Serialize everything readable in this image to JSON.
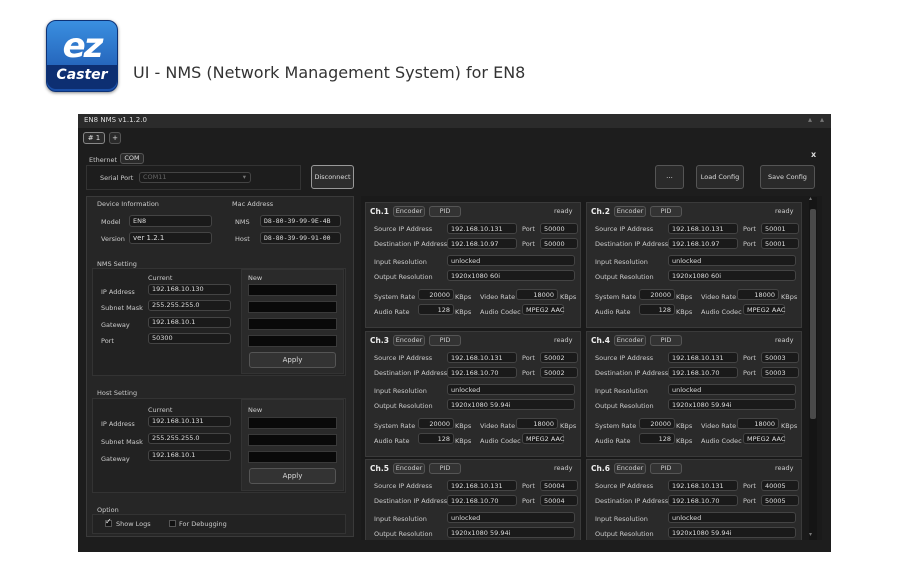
{
  "header": {
    "logo_top": "ez",
    "logo_bottom": "Caster",
    "caption": "UI - NMS (Network Management System) for EN8"
  },
  "window": {
    "title": "EN8 NMS v1.1.2.0",
    "tab": "# 1",
    "add_tab": "+",
    "close": "x"
  },
  "conn": {
    "tab_ethernet": "Ethernet",
    "tab_com": "COM",
    "serial_label": "Serial Port",
    "serial_value": "COM11",
    "disconnect": "Disconnect",
    "dots": "...",
    "load": "Load Config",
    "save": "Save Config"
  },
  "device": {
    "title": "Device Information",
    "model_label": "Model",
    "model": "EN8",
    "version_label": "Version",
    "version": "ver 1.2.1",
    "mac_title": "Mac Address",
    "nms_label": "NMS",
    "nms_mac": "D8-80-39-99-9E-4B",
    "host_label": "Host",
    "host_mac": "D8-80-39-99-91-00"
  },
  "nms": {
    "title": "NMS Setting",
    "current": "Current",
    "new": "New",
    "ip_label": "IP Address",
    "ip": "192.168.10.130",
    "mask_label": "Subnet Mask",
    "mask": "255.255.255.0",
    "gw_label": "Gateway",
    "gw": "192.168.10.1",
    "port_label": "Port",
    "port": "50300",
    "apply": "Apply"
  },
  "host": {
    "title": "Host Setting",
    "current": "Current",
    "new": "New",
    "ip_label": "IP Address",
    "ip": "192.168.10.131",
    "mask_label": "Subnet Mask",
    "mask": "255.255.255.0",
    "gw_label": "Gateway",
    "gw": "192.168.10.1",
    "apply": "Apply"
  },
  "option": {
    "title": "Option",
    "show_logs": "Show Logs",
    "debug": "For Debugging",
    "check": "✓"
  },
  "labels": {
    "encoder": "Encoder",
    "pid": "PID",
    "src": "Source IP Address",
    "dst": "Destination IP Address",
    "port": "Port",
    "input_res": "Input Resolution",
    "output_res": "Output Resolution",
    "sys_rate": "System Rate",
    "kbps": "KBps",
    "video_rate": "Video Rate",
    "audio_rate": "Audio Rate",
    "audio_codec": "Audio Codec"
  },
  "channels": [
    {
      "name": "Ch.1",
      "status": "ready",
      "src_ip": "192.168.10.131",
      "src_port": "50000",
      "dst_ip": "192.168.10.97",
      "dst_port": "50000",
      "input_res": "unlocked",
      "output_res": "1920x1080 60i",
      "system_rate": "20000",
      "video_rate": "18000",
      "audio_rate": "128",
      "audio_codec": "MPEG2 AAC"
    },
    {
      "name": "Ch.2",
      "status": "ready",
      "src_ip": "192.168.10.131",
      "src_port": "50001",
      "dst_ip": "192.168.10.97",
      "dst_port": "50001",
      "input_res": "unlocked",
      "output_res": "1920x1080 60i",
      "system_rate": "20000",
      "video_rate": "18000",
      "audio_rate": "128",
      "audio_codec": "MPEG2 AAC"
    },
    {
      "name": "Ch.3",
      "status": "ready",
      "src_ip": "192.168.10.131",
      "src_port": "50002",
      "dst_ip": "192.168.10.70",
      "dst_port": "50002",
      "input_res": "unlocked",
      "output_res": "1920x1080 59.94i",
      "system_rate": "20000",
      "video_rate": "18000",
      "audio_rate": "128",
      "audio_codec": "MPEG2 AAC"
    },
    {
      "name": "Ch.4",
      "status": "ready",
      "src_ip": "192.168.10.131",
      "src_port": "50003",
      "dst_ip": "192.168.10.70",
      "dst_port": "50003",
      "input_res": "unlocked",
      "output_res": "1920x1080 59.94i",
      "system_rate": "20000",
      "video_rate": "18000",
      "audio_rate": "128",
      "audio_codec": "MPEG2 AAC"
    },
    {
      "name": "Ch.5",
      "status": "ready",
      "src_ip": "192.168.10.131",
      "src_port": "50004",
      "dst_ip": "192.168.10.70",
      "dst_port": "50004",
      "input_res": "unlocked",
      "output_res": "1920x1080 59.94i",
      "system_rate": "",
      "video_rate": "",
      "audio_rate": "",
      "audio_codec": ""
    },
    {
      "name": "Ch.6",
      "status": "ready",
      "src_ip": "192.168.10.131",
      "src_port": "40005",
      "dst_ip": "192.168.10.70",
      "dst_port": "50005",
      "input_res": "unlocked",
      "output_res": "1920x1080 59.94i",
      "system_rate": "",
      "video_rate": "",
      "audio_rate": "",
      "audio_codec": ""
    }
  ]
}
